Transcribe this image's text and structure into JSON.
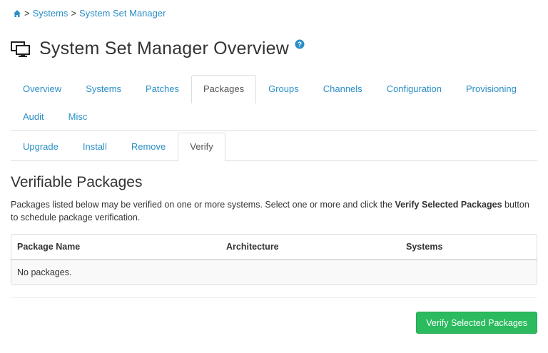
{
  "breadcrumb": {
    "home_icon": "home-icon",
    "sep1": ">",
    "systems": "Systems",
    "sep2": ">",
    "ssm": "System Set Manager"
  },
  "header": {
    "icon": "system-set-icon",
    "title": "System Set Manager Overview",
    "help_icon": "help-icon"
  },
  "primary_tabs": [
    {
      "label": "Overview",
      "active": false
    },
    {
      "label": "Systems",
      "active": false
    },
    {
      "label": "Patches",
      "active": false
    },
    {
      "label": "Packages",
      "active": true
    },
    {
      "label": "Groups",
      "active": false
    },
    {
      "label": "Channels",
      "active": false
    },
    {
      "label": "Configuration",
      "active": false
    },
    {
      "label": "Provisioning",
      "active": false
    },
    {
      "label": "Audit",
      "active": false
    },
    {
      "label": "Misc",
      "active": false
    }
  ],
  "secondary_tabs": [
    {
      "label": "Upgrade",
      "active": false
    },
    {
      "label": "Install",
      "active": false
    },
    {
      "label": "Remove",
      "active": false
    },
    {
      "label": "Verify",
      "active": true
    }
  ],
  "section": {
    "title": "Verifiable Packages",
    "desc_before": "Packages listed below may be verified on one or more systems. Select one or more and click the ",
    "desc_bold": "Verify Selected Packages",
    "desc_after": " button to schedule package verification."
  },
  "table": {
    "columns": [
      "Package Name",
      "Architecture",
      "Systems"
    ],
    "empty_message": "No packages."
  },
  "actions": {
    "verify_button": "Verify Selected Packages"
  },
  "colors": {
    "link": "#2a8fc7",
    "button_green": "#2bbb5e"
  }
}
